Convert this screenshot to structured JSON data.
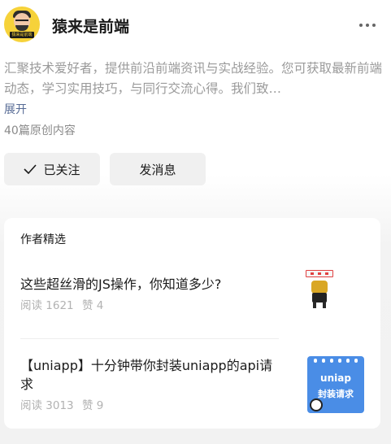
{
  "profile": {
    "name": "猿来是前端",
    "avatar_tag": "猿来是前端",
    "description": "汇聚技术爱好者，提供前沿前端资讯与实战经验。您可获取最新前端动态，学习实用技巧，与同行交流心得。我们致…",
    "expand_label": "展开",
    "article_count": "40篇原创内容"
  },
  "actions": {
    "follow_label": "已关注",
    "message_label": "发消息"
  },
  "featured": {
    "title": "作者精选",
    "articles": [
      {
        "title": "这些超丝滑的JS操作，你知道多少?",
        "reads": "阅读 1621",
        "likes": "赞 4",
        "thumb_icon": "gold-figure-image"
      },
      {
        "title": "【uniapp】十分钟带你封装uniapp的api请求",
        "reads": "阅读 3013",
        "likes": "赞 9",
        "thumb_icon": "uniapp-cover-image",
        "thumb_line1": "uniap",
        "thumb_line2": "封装请求"
      }
    ]
  },
  "colors": {
    "link": "#576b95",
    "thumb_blue": "#4a8de6"
  }
}
